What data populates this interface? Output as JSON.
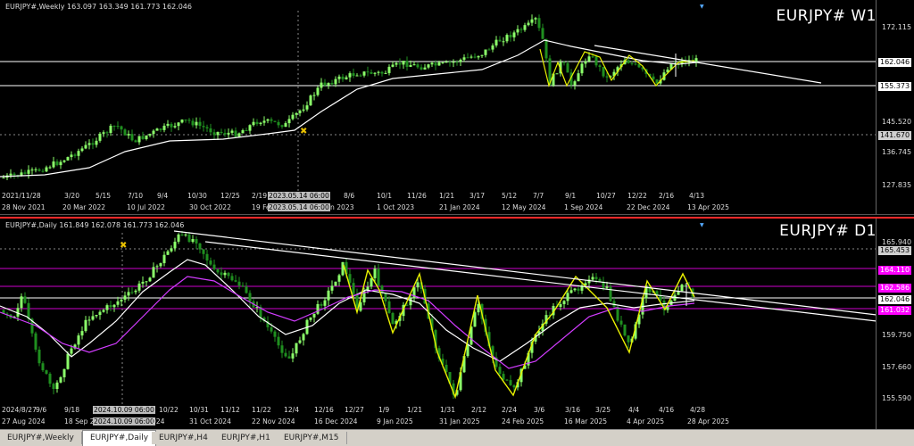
{
  "top": {
    "header": "EURJPY#,Weekly  163.097 163.349 161.773 162.046",
    "label": "EURJPY# W1",
    "prices": [
      "172.115",
      "162.046",
      "155.373",
      "145.520",
      "141.670",
      "136.745",
      "127.835"
    ],
    "date_labels": [
      "2021/11/28",
      "3/20",
      "5/15",
      "7/10",
      "9/4",
      "10/30",
      "12/25",
      "2/19",
      "2023.05.14 06:00",
      "8/6",
      "10/1",
      "11/26",
      "1/21",
      "3/17",
      "5/12",
      "7/7",
      "9/1",
      "10/27",
      "12/22",
      "2/16",
      "4/13"
    ],
    "date_row2": [
      "28 Nov 2021",
      "20 Mar 2022",
      "10 Jul 2022",
      "30 Oct 2022",
      "19 Fe",
      "2023.05.14 06:00",
      "n 2023",
      "1 Oct 2023",
      "21 Jan 2024",
      "12 May 2024",
      "1 Sep 2024",
      "22 Dec 2024",
      "13 Apr 2025"
    ]
  },
  "bottom": {
    "header": "EURJPY#,Daily  161.849 162.078 161.773 162.046",
    "label": "EURJPY# D1",
    "prices": [
      "165.940",
      "165.453",
      "164.110",
      "162.586",
      "162.046",
      "161.032",
      "159.750",
      "157.660",
      "155.590"
    ],
    "date_labels": [
      "2024/8/27",
      "9/6",
      "9/18",
      "2024.10.09 06:00",
      "10/22",
      "10/31",
      "11/12",
      "11/22",
      "12/4",
      "12/16",
      "12/27",
      "1/9",
      "1/21",
      "1/31",
      "2/12",
      "2/24",
      "3/6",
      "3/16",
      "3/25",
      "4/4",
      "4/16",
      "4/28"
    ],
    "date_row2": [
      "27 Aug 2024",
      "18 Sep 2",
      "2024.10.09 06:00",
      "024",
      "31 Oct 2024",
      "22 Nov 2024",
      "16 Dec 2024",
      "9 Jan 2025",
      "31 Jan 2025",
      "24 Feb 2025",
      "16 Mar 2025",
      "4 Apr 2025",
      "28 Apr 2025"
    ]
  },
  "tabs": [
    "EURJPY#,Weekly",
    "EURJPY#,Daily",
    "EURJPY#,H4",
    "EURJPY#,H1",
    "EURJPY#,M15"
  ],
  "colors": {
    "bull": "#8bff6a",
    "bear": "#1f8f1f",
    "ma_white": "#ffffff",
    "ma_magenta": "#d23cff",
    "zigzag": "#e8f000",
    "level": "#cc00cc"
  }
}
